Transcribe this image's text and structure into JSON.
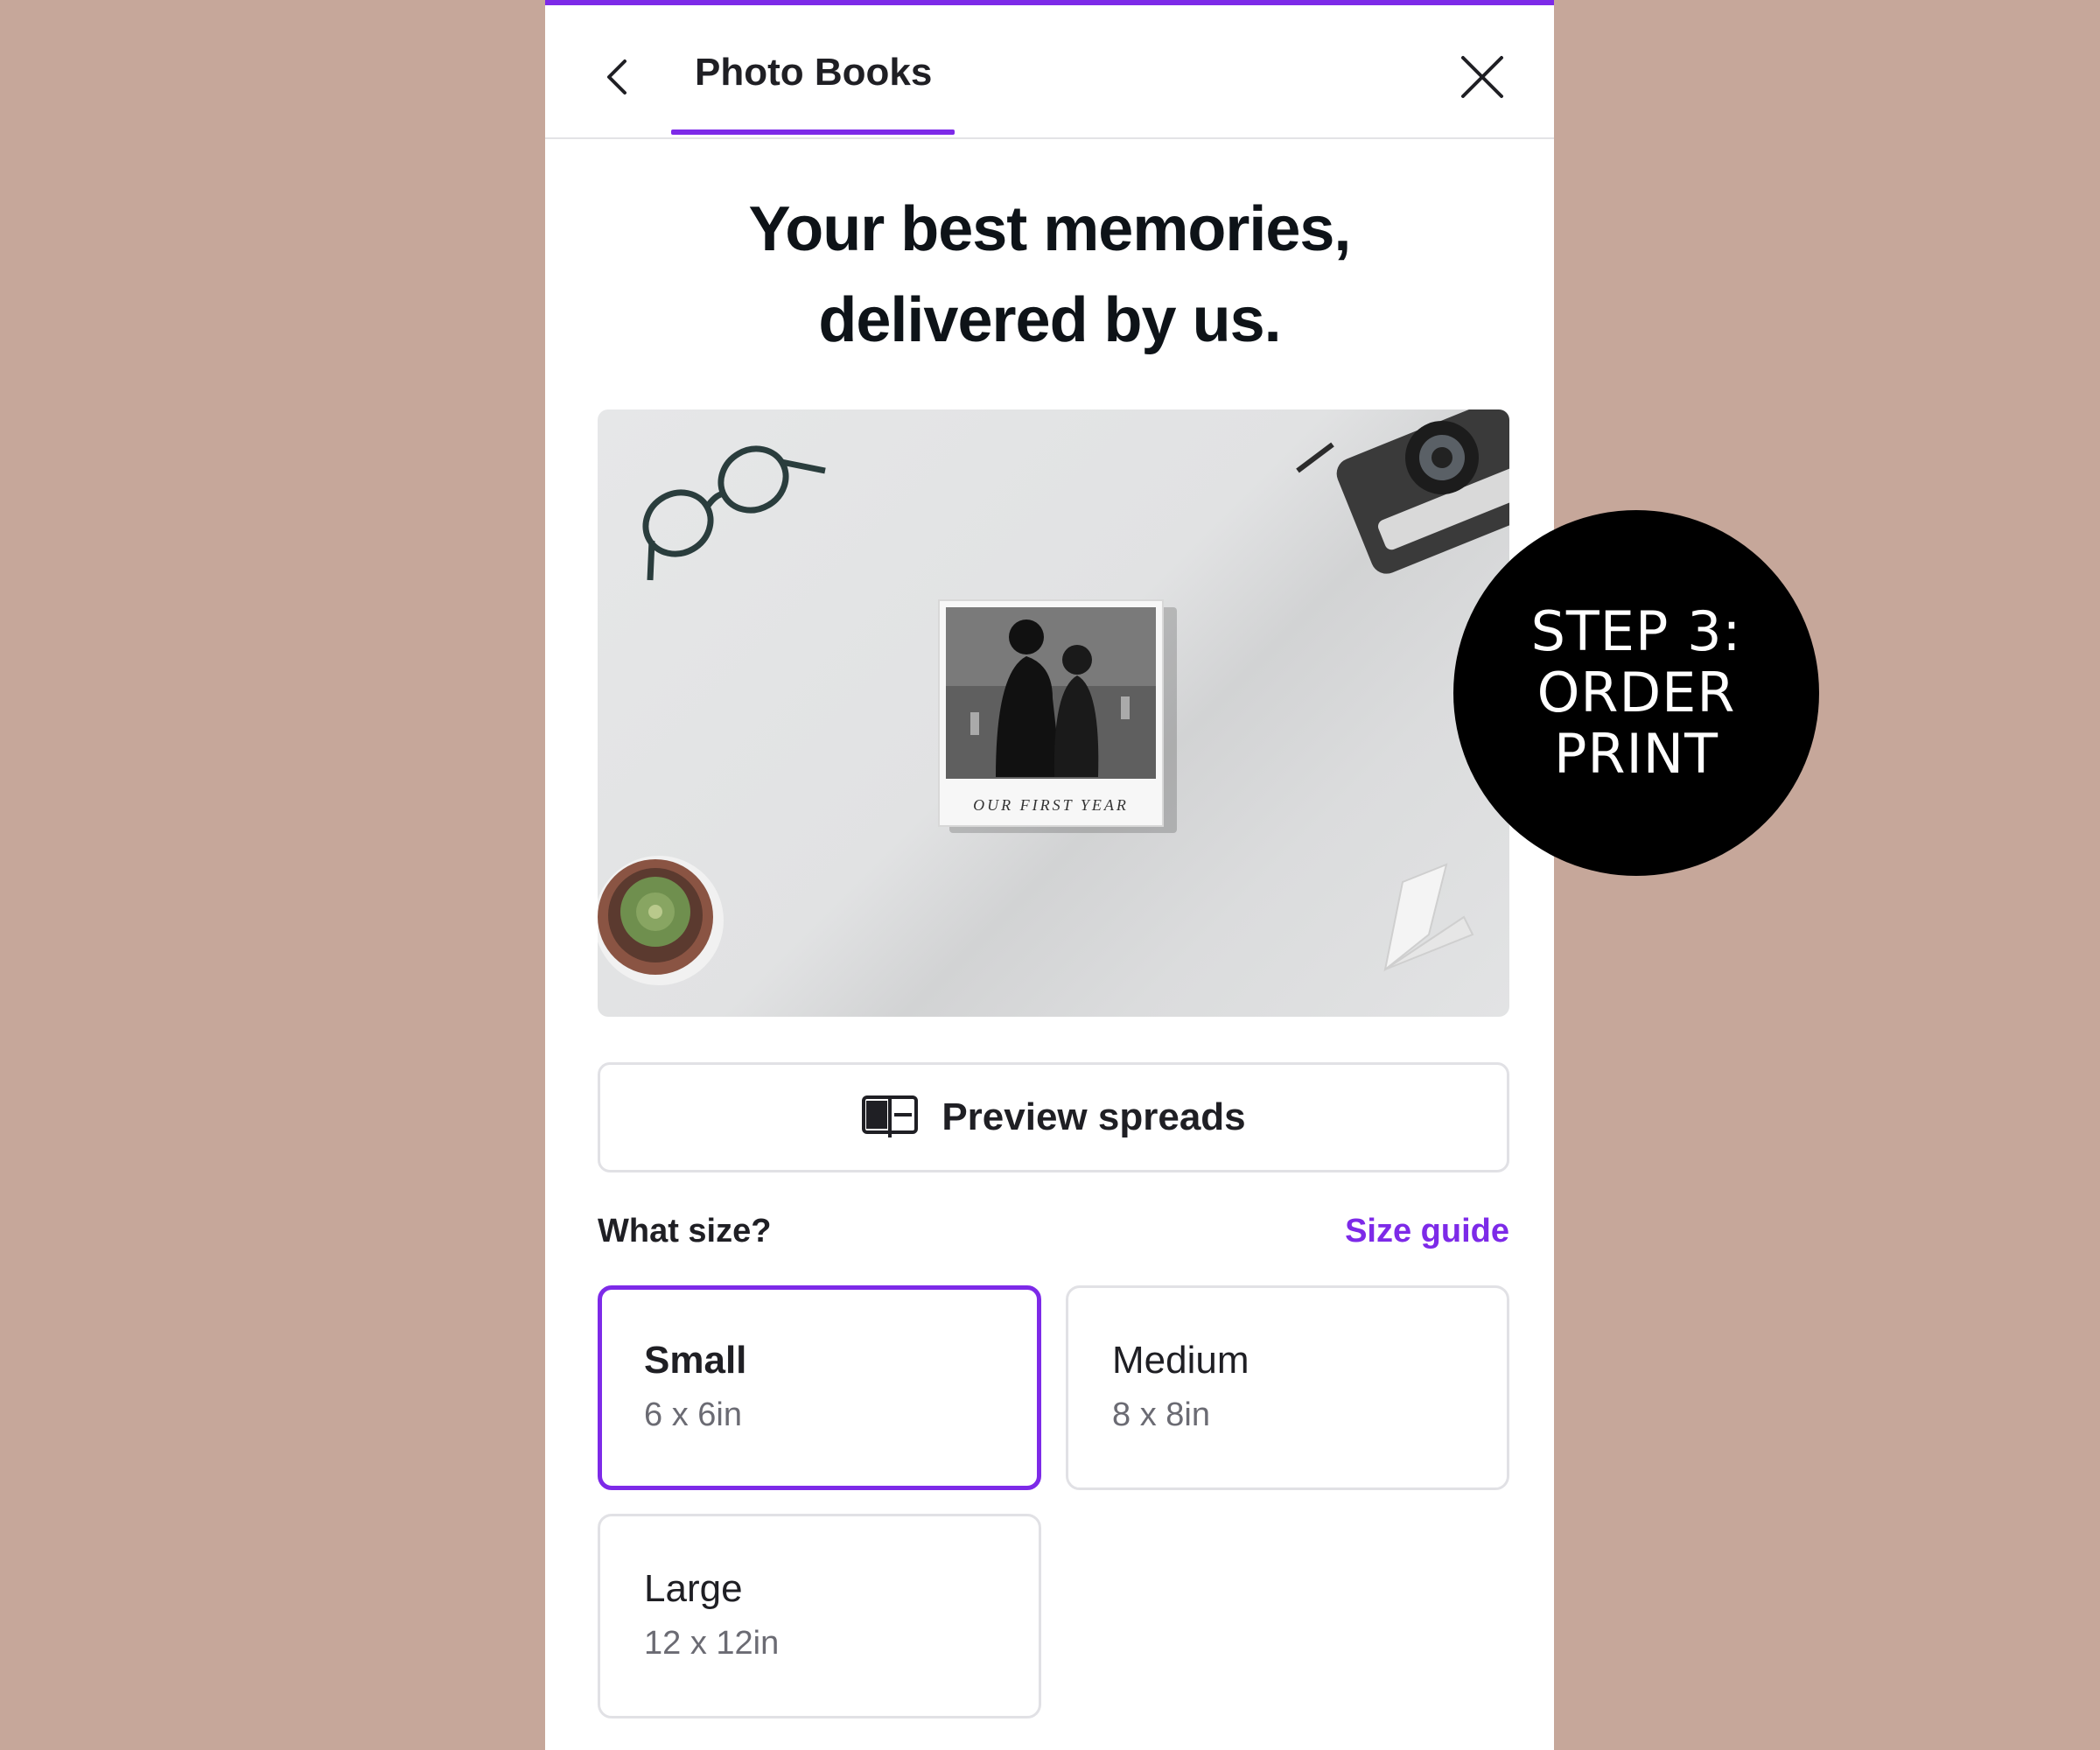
{
  "header": {
    "tab_label": "Photo Books",
    "back_icon": "chevron-left-icon",
    "close_icon": "close-icon"
  },
  "headline": {
    "line1": "Your best memories,",
    "line2": "delivered by us."
  },
  "hero": {
    "book_caption": "OUR FIRST YEAR"
  },
  "preview": {
    "label": "Preview spreads",
    "icon": "open-book-icon"
  },
  "size": {
    "question": "What size?",
    "guide_link": "Size guide",
    "options": [
      {
        "name": "Small",
        "dims": "6 x 6in",
        "selected": true
      },
      {
        "name": "Medium",
        "dims": "8 x 8in",
        "selected": false
      },
      {
        "name": "Large",
        "dims": "12 x 12in",
        "selected": false
      }
    ]
  },
  "badge": {
    "line1": "STEP 3:",
    "line2": "ORDER",
    "line3": "PRINT"
  },
  "colors": {
    "accent": "#7d2ae8",
    "background": "#c6a79a",
    "badge": "#000000"
  }
}
